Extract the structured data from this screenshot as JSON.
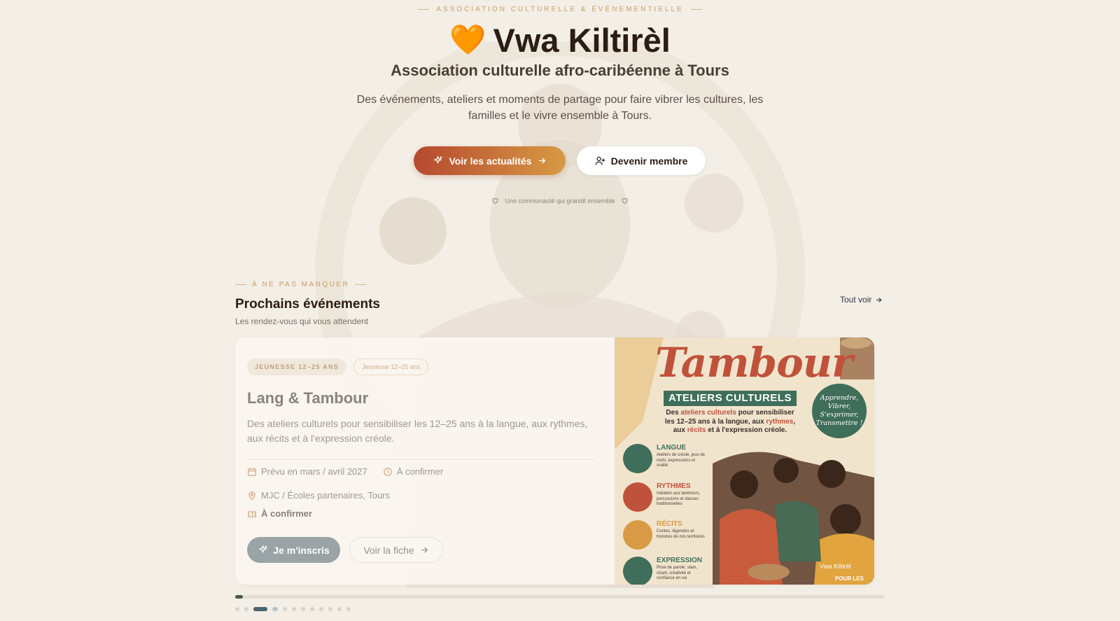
{
  "colors": {
    "background": "#f3eee6",
    "accent_start": "#b5492f",
    "accent_end": "#d89a44",
    "gold": "#c8a066",
    "dark": "#2b1d14",
    "green": "#3f6e5a"
  },
  "hero": {
    "eyebrow": "ASSOCIATION CULTURELLE & ÉVÉNEMENTIELLE",
    "logo_emoji": "🧡",
    "title": "Vwa Kiltirèl",
    "subtitle": "Association culturelle afro-caribéenne à Tours",
    "description": "Des événements, ateliers et moments de partage pour faire vibrer les cultures, les familles et le vivre ensemble à Tours.",
    "primary_button": {
      "label": "Voir les actualités",
      "icon": "sparkles-icon",
      "trailing_icon": "arrow-right-icon"
    },
    "secondary_button": {
      "label": "Devenir membre",
      "icon": "user-plus-icon"
    },
    "tagline": "Une communauté qui grandit ensemble"
  },
  "events_section": {
    "eyebrow": "À NE PAS MANQUER",
    "title": "Prochains événements",
    "subtitle": "Les rendez-vous qui vous attendent",
    "see_all": "Tout voir",
    "card": {
      "badges": [
        "JEUNESSE 12–25 ANS",
        "Jeunesse 12–25 ans"
      ],
      "title": "Lang & Tambour",
      "description": "Des ateliers culturels pour sensibiliser les 12–25 ans à la langue, aux rythmes, aux récits et à l'expression créole.",
      "date": "Prévu en mars / avril 2027",
      "time": "À confirmer",
      "location": "MJC / Écoles partenaires, Tours",
      "price": "À confirmer",
      "join_button": "Je m'inscris",
      "sheet_button": "Voir la fiche",
      "poster": {
        "title": "Tambour",
        "ribbon": "ATELIERS CULTURELS",
        "desc_pre": "Des ",
        "desc_h1": "ateliers culturels",
        "desc_mid1": " pour sensibiliser les 12–25 ans à la langue, aux ",
        "desc_h2": "rythmes",
        "desc_mid2": ", aux ",
        "desc_h3": "récits",
        "desc_post": " et à l'expression créole.",
        "seal": "Apprendre, Vibrer, S'exprimer, Transmettre !",
        "features": [
          {
            "label": "LANGUE",
            "text": "Ateliers de créole, jeux de mots, expressions et oralité",
            "color": "#3f6e5a"
          },
          {
            "label": "RYTHMES",
            "text": "Initiation aux tambours, percussions et danses traditionnelles",
            "color": "#c0523b"
          },
          {
            "label": "RÉCITS",
            "text": "Contes, légendes et histoires de nos territoires",
            "color": "#d89a44"
          },
          {
            "label": "EXPRESSION",
            "text": "Prise de parole, slam, chant, créativité et confiance en soi",
            "color": "#3f6e5a"
          }
        ],
        "watermark": "Vwa Kiltirèl",
        "corner_text": "POUR LES"
      }
    },
    "carousel": {
      "progress": 0.01,
      "total_slides": 12,
      "active_index": 2
    }
  }
}
